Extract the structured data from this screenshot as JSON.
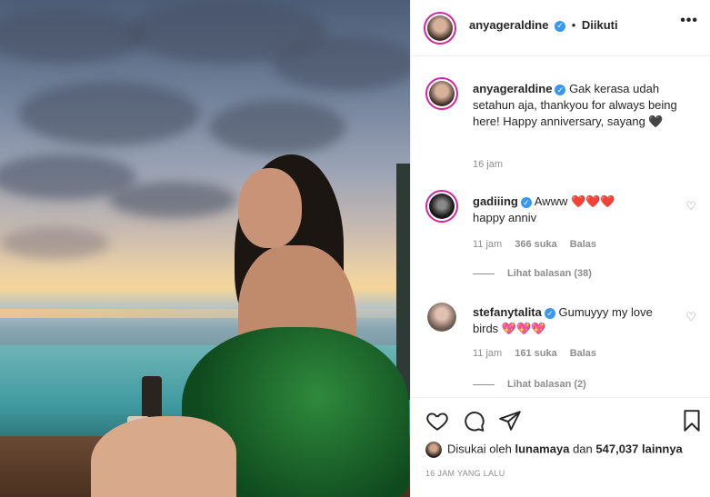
{
  "post": {
    "author": "anyageraldine",
    "follow_label": "Diikuti",
    "separator": "•",
    "more": "•••"
  },
  "caption": {
    "username": "anyageraldine",
    "text": "Gak kerasa udah setahun aja, thankyou for always being here! Happy anniversary, sayang 🖤",
    "time": "16 jam"
  },
  "comments": [
    {
      "username": "gadiiing",
      "text": "Awww",
      "hearts": "❤️❤️❤️",
      "text2": "happy anniv",
      "time": "11 jam",
      "likes": "366 suka",
      "reply": "Balas",
      "view_replies": "Lihat balasan (38)"
    },
    {
      "username": "stefanytalita",
      "text": "Gumuyyy my love birds",
      "hearts": "💖💖💖",
      "time": "11 jam",
      "likes": "161 suka",
      "reply": "Balas",
      "view_replies": "Lihat balasan (2)"
    }
  ],
  "likes_line": {
    "prefix": "Disukai oleh",
    "user": "lunamaya",
    "mid": "dan",
    "count": "547,037 lainnya"
  },
  "timestamp": "16 JAM YANG LALU",
  "icons": [
    "heart-icon",
    "comment-icon",
    "share-icon",
    "bookmark-icon",
    "verified-icon",
    "more-icon"
  ],
  "colors": {
    "verified": "#3897f0",
    "ring": "#d6249f",
    "muted": "#8e8e8e"
  }
}
